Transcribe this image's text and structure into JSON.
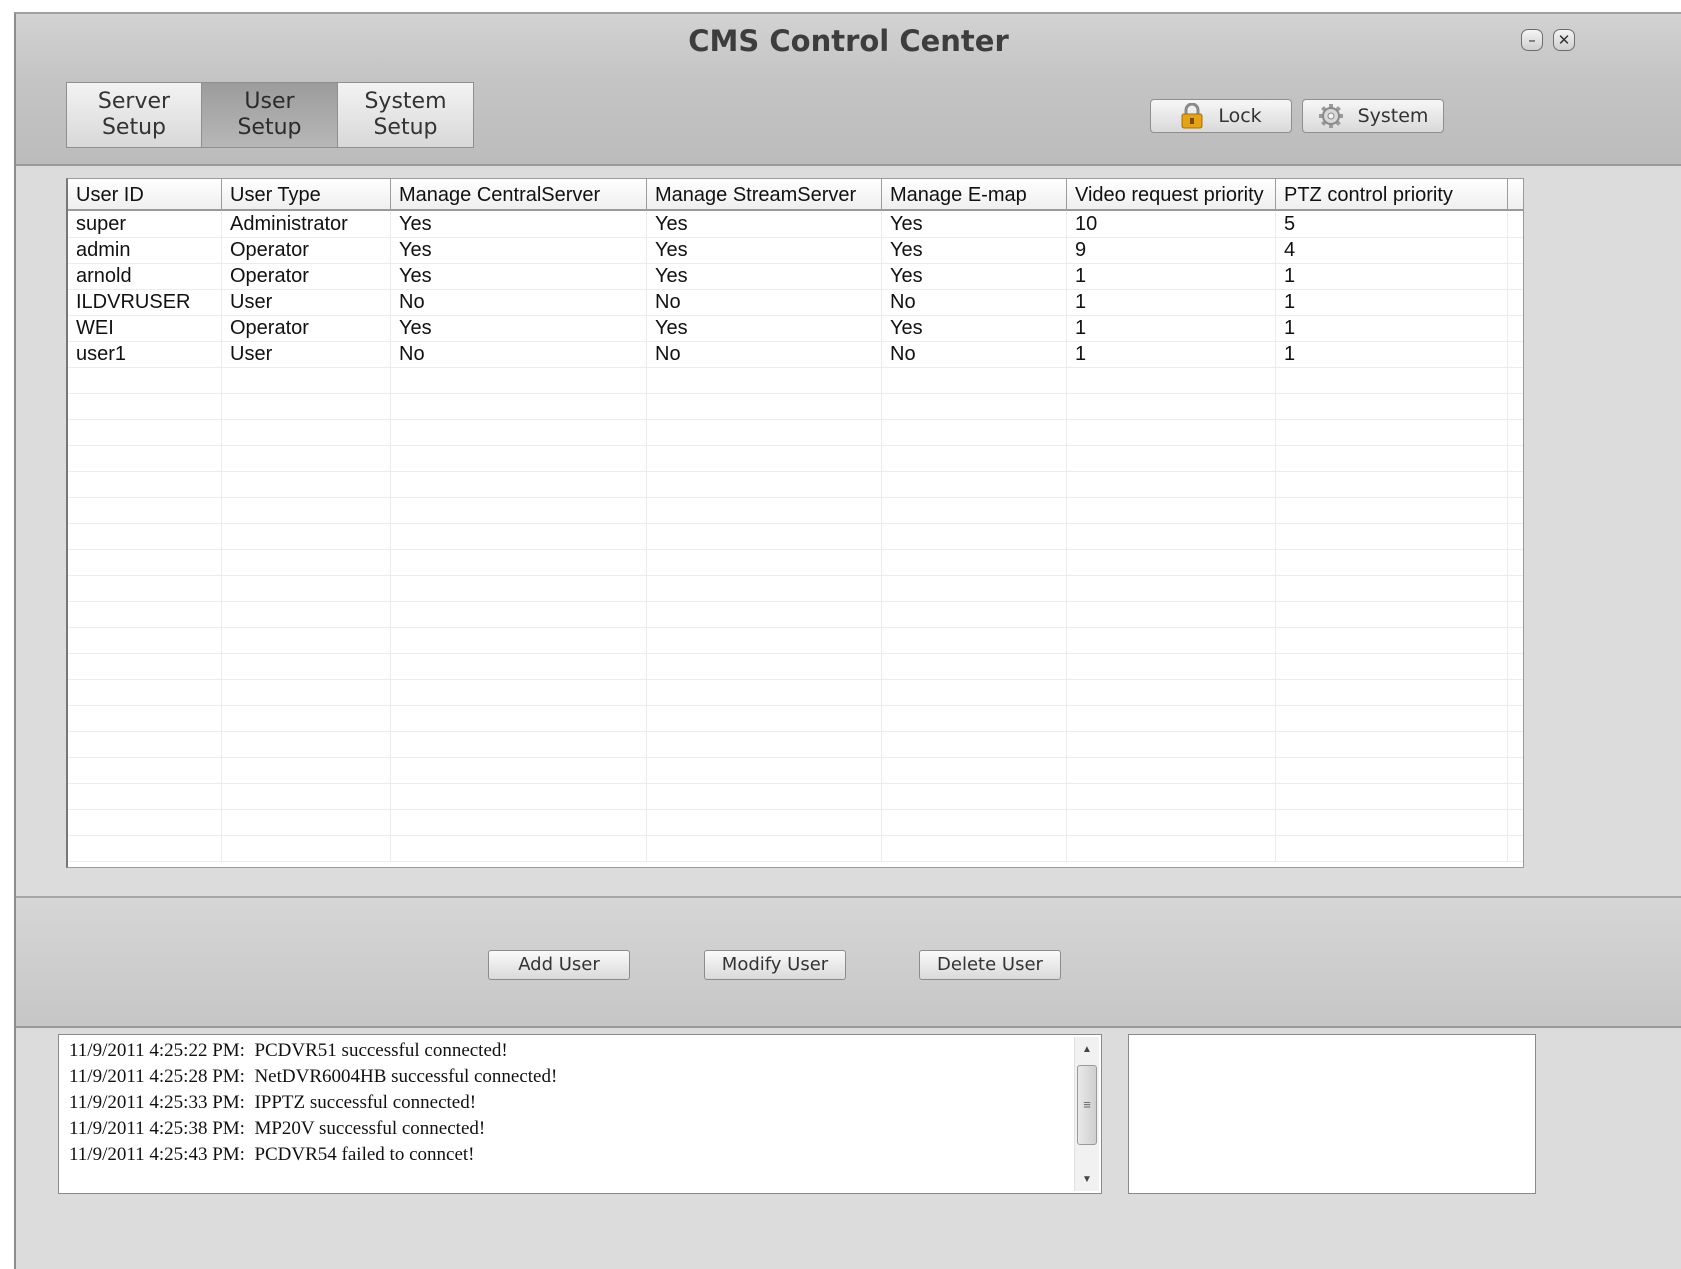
{
  "window": {
    "title": "CMS Control Center",
    "minimize_glyph": "–",
    "close_glyph": "✕"
  },
  "tabs": [
    {
      "line1": "Server",
      "line2": "Setup",
      "active": false
    },
    {
      "line1": "User",
      "line2": "Setup",
      "active": true
    },
    {
      "line1": "System",
      "line2": "Setup",
      "active": false
    }
  ],
  "top_buttons": {
    "lock_label": "Lock",
    "lock_icon": "padlock-icon",
    "system_label": "System",
    "system_icon": "gear-icon"
  },
  "table": {
    "columns": [
      "User ID",
      "User Type",
      "Manage CentralServer",
      "Manage StreamServer",
      "Manage E-map",
      "Video request priority",
      "PTZ control priority"
    ],
    "rows": [
      [
        "super",
        "Administrator",
        "Yes",
        "Yes",
        "Yes",
        "10",
        "5"
      ],
      [
        "admin",
        "Operator",
        "Yes",
        "Yes",
        "Yes",
        "9",
        "4"
      ],
      [
        "arnold",
        "Operator",
        "Yes",
        "Yes",
        "Yes",
        "1",
        "1"
      ],
      [
        "ILDVRUSER",
        "User",
        "No",
        "No",
        "No",
        "1",
        "1"
      ],
      [
        "WEI",
        "Operator",
        "Yes",
        "Yes",
        "Yes",
        "1",
        "1"
      ],
      [
        "user1",
        "User",
        "No",
        "No",
        "No",
        "1",
        "1"
      ]
    ]
  },
  "actions": {
    "add_user": "Add User",
    "modify_user": "Modify User",
    "delete_user": "Delete User"
  },
  "log": {
    "lines": [
      "11/9/2011 4:25:22 PM:  PCDVR51 successful connected!",
      "11/9/2011 4:25:28 PM:  NetDVR6004HB successful connected!",
      "11/9/2011 4:25:33 PM:  IPPTZ successful connected!",
      "11/9/2011 4:25:38 PM:  MP20V successful connected!",
      "11/9/2011 4:25:43 PM:  PCDVR54 failed to conncet!"
    ],
    "scroll_up_glyph": "▲",
    "scroll_down_glyph": "▼",
    "scroll_grip_glyph": "≡"
  },
  "colors": {
    "chrome_gray": "#c4c4c4",
    "active_tab": "#a8a8a8",
    "lock_icon": "#e2a21a"
  }
}
